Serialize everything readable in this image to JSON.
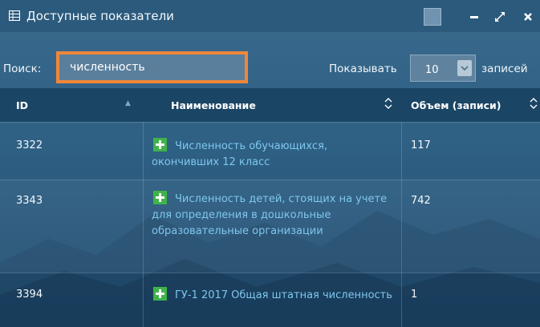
{
  "window": {
    "title": "Доступные показатели",
    "icons": [
      "table-icon",
      "square-icon",
      "minimize-icon",
      "expand-icon",
      "close-icon"
    ]
  },
  "toolbar": {
    "search_label": "Поиск:",
    "search_value": "численность",
    "show_label": "Показывать",
    "page_length": "10",
    "records_label": "записей"
  },
  "table": {
    "headers": {
      "id": "ID",
      "name": "Наименование",
      "volume": "Объем (записи)"
    },
    "rows": [
      {
        "id": "3322",
        "name": "Численность обучающихся, окончивших 12 класс",
        "volume": "117"
      },
      {
        "id": "3343",
        "name": "Численность детей, стоящих на учете для определения в дошкольные образовательные организации",
        "volume": "742"
      },
      {
        "id": "3394",
        "name": "ГУ-1 2017 Общая штатная численность",
        "volume": "1"
      }
    ]
  },
  "colors": {
    "accent_search_border": "#f0873a",
    "add_button": "#3fb34a",
    "link": "#7fc6ee",
    "header_bg": "#1b4565"
  }
}
